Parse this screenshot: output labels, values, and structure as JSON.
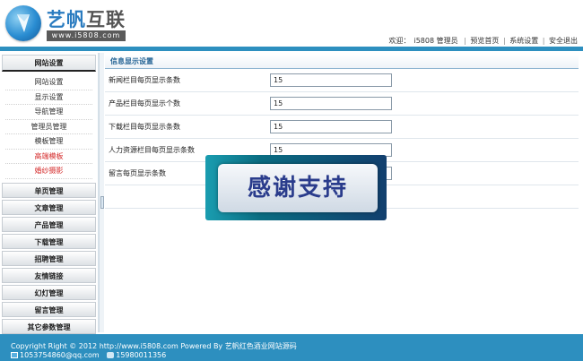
{
  "header": {
    "brand_main": "艺帆",
    "brand_accent": "互联",
    "url_badge": "www.i5808.com",
    "nav": {
      "welcome": "欢迎：",
      "user": "i5808 管理员",
      "sep": "|",
      "home": "预览首页",
      "settings": "系统设置",
      "logout": "安全退出"
    }
  },
  "sidebar": {
    "active_group": "网站设置",
    "sub_items": [
      {
        "label": "网站设置",
        "color": "normal"
      },
      {
        "label": "显示设置",
        "color": "normal"
      },
      {
        "label": "导航管理",
        "color": "normal"
      },
      {
        "label": "管理员管理",
        "color": "normal"
      },
      {
        "label": "模板管理",
        "color": "normal"
      },
      {
        "label": "高端模板",
        "color": "red"
      },
      {
        "label": "婚纱摄影",
        "color": "red"
      }
    ],
    "groups": [
      "单页管理",
      "文章管理",
      "产品管理",
      "下载管理",
      "招聘管理",
      "友情链接",
      "幻灯管理",
      "留言管理",
      "其它参数管理"
    ]
  },
  "main": {
    "panel_title": "信息显示设置",
    "rows": [
      {
        "label": "新闻栏目每页显示条数",
        "value": "15"
      },
      {
        "label": "产品栏目每页显示个数",
        "value": "15"
      },
      {
        "label": "下载栏目每页显示条数",
        "value": "15"
      },
      {
        "label": "人力资源栏目每页显示条数",
        "value": "15"
      },
      {
        "label": "留言每页显示条数",
        "value": ""
      }
    ]
  },
  "overlay": {
    "text": "感谢支持"
  },
  "footer": {
    "copyright": "Copyright Right © 2012 http://www.i5808.com Powered By 艺帆红色酒业网站源码",
    "email": "1053754860@qq.com",
    "phone": "15980011356"
  },
  "colors": {
    "accent_blue": "#2d8fbf",
    "title_blue": "#1e5f92",
    "red_item": "#d42a2a"
  }
}
